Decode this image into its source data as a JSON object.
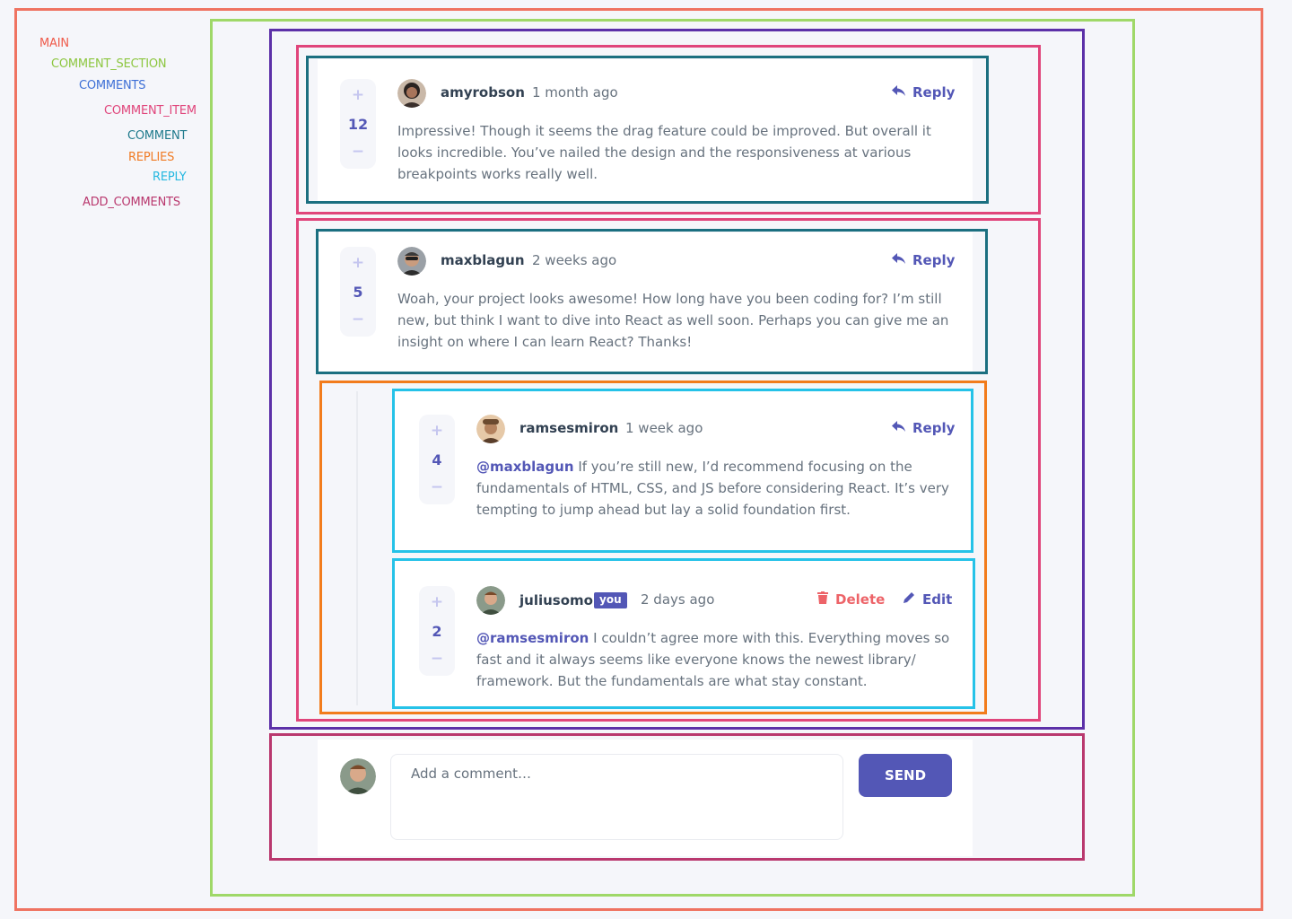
{
  "legend": {
    "main": "MAIN",
    "comment_section": "COMMENT_SECTION",
    "comments": "COMMENTS",
    "comment_item": "COMMENT_ITEM",
    "comment": "COMMENT",
    "replies": "REPLIES",
    "reply": "REPLY",
    "add_comments": "ADD_COMMENTS"
  },
  "comments": [
    {
      "username": "amyrobson",
      "time": "1 month ago",
      "score": "12",
      "action": "Reply",
      "text": "Impressive! Though it seems the drag feature could be improved. But overall it looks incredible. You’ve nailed the design and the responsiveness at various breakpoints works really well."
    },
    {
      "username": "maxblagun",
      "time": "2 weeks ago",
      "score": "5",
      "action": "Reply",
      "text": "Woah, your project looks awesome! How long have you been coding for? I’m still new, but think I want to dive into React as well soon. Perhaps you can give me an insight on where I can learn React? Thanks!"
    }
  ],
  "replies": [
    {
      "username": "ramsesmiron",
      "time": "1 week ago",
      "score": "4",
      "action": "Reply",
      "mention": "@maxblagun",
      "text": "If you’re still new, I’d recommend focusing on the fundamentals of HTML, CSS, and JS before considering React. It’s very tempting to jump ahead but lay a solid foundation first."
    },
    {
      "username": "juliusomo",
      "badge": "you",
      "time": "2 days ago",
      "score": "2",
      "delete_label": "Delete",
      "edit_label": "Edit",
      "mention": "@ramsesmiron",
      "text": "I couldn’t agree more with this. Everything moves so fast and it always seems like everyone knows the newest library/ framework. But the fundamentals are what stay constant."
    }
  ],
  "vote": {
    "plus": "+",
    "minus": "−"
  },
  "add_comment": {
    "placeholder": "Add a comment…",
    "send_label": "SEND"
  },
  "colors": {
    "accent": "#5357b6",
    "danger": "#ed6368",
    "text": "#67727e",
    "heading": "#324152",
    "background": "#f5f6fa"
  }
}
